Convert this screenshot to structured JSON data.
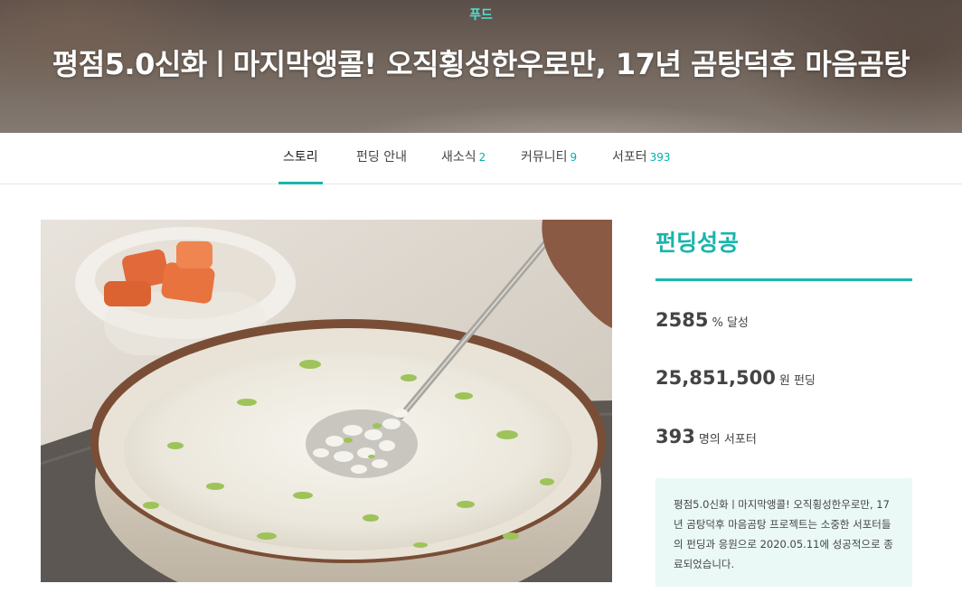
{
  "header": {
    "category": "푸드",
    "title": "평점5.0신화ㅣ마지막앵콜! 오직횡성한우로만, 17년 곰탕덕후 마음곰탕"
  },
  "tabs": [
    {
      "label": "스토리",
      "count": ""
    },
    {
      "label": "펀딩 안내",
      "count": ""
    },
    {
      "label": "새소식",
      "count": "2"
    },
    {
      "label": "커뮤니티",
      "count": "9"
    },
    {
      "label": "서포터",
      "count": "393"
    }
  ],
  "funding": {
    "status": "펀딩성공",
    "percent": "2585",
    "percent_unit": "% 달성",
    "amount": "25,851,500",
    "amount_unit": "원 펀딩",
    "supporters": "393",
    "supporters_unit": "명의 서포터",
    "notice": "평점5.0신화ㅣ마지막앵콜! 오직횡성한우로만, 17년 곰탕덕후 마음곰탕 프로젝트는 소중한 서포터들의 펀딩과 응원으로 2020.05.11에 성공적으로 종료되었습니다."
  },
  "colors": {
    "accent": "#1ab6ad",
    "category": "#4ee0d4",
    "notice_bg": "#eaf9f6"
  }
}
